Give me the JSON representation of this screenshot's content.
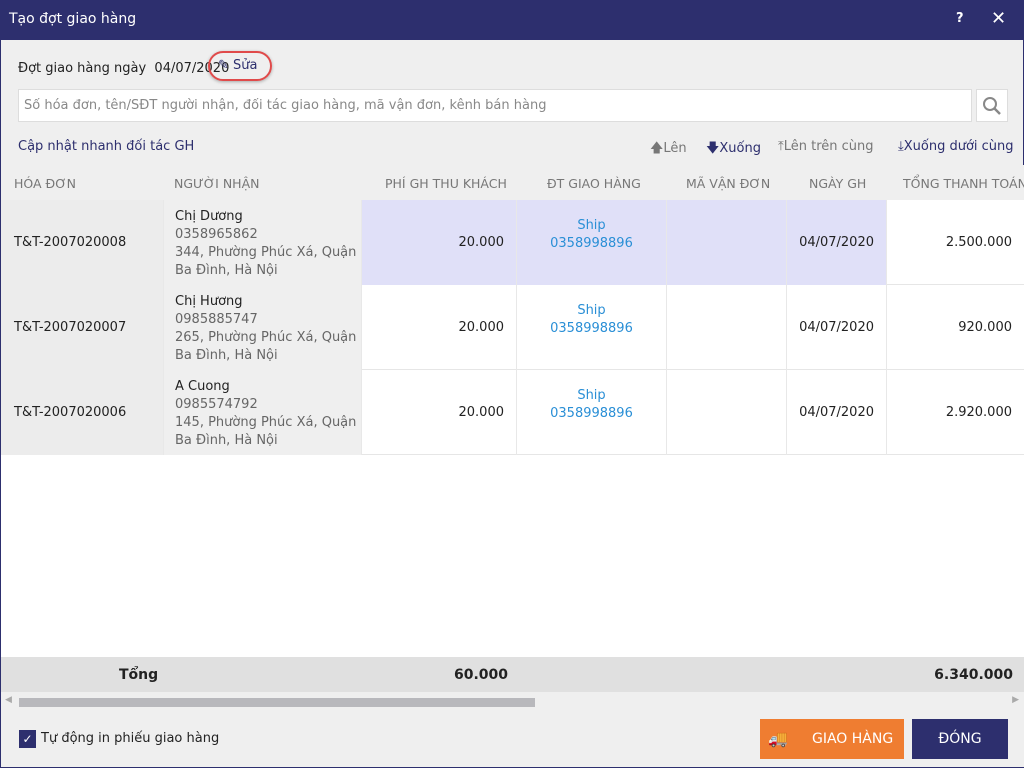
{
  "window": {
    "title": "Tạo đợt giao hàng",
    "help": "?",
    "close": "✕"
  },
  "batch": {
    "label": "Đợt giao hàng ngày",
    "date": "04/07/2020",
    "edit_label": "Sửa"
  },
  "search": {
    "placeholder": "Số hóa đơn, tên/SĐT người nhận, đối tác giao hàng, mã vận đơn, kênh bán hàng",
    "value": ""
  },
  "quick_update": "Cập nhật nhanh đối tác GH",
  "actions": {
    "up": "Lên",
    "down": "Xuống",
    "top": "Lên trên cùng",
    "bottom": "Xuống dưới cùng"
  },
  "columns": [
    "HÓA ĐƠN",
    "NGƯỜI NHẬN",
    "PHÍ GH THU KHÁCH",
    "ĐT GIAO HÀNG",
    "MÃ VẬN ĐƠN",
    "NGÀY GH",
    "TỔNG THANH TOÁN"
  ],
  "rows": [
    {
      "invoice": "T&T-2007020008",
      "name": "Chị Dương",
      "phone": "0358965862",
      "addr1": "344, Phường Phúc Xá, Quận",
      "addr2": "Ba Đình, Hà Nội",
      "fee": "20.000",
      "partner": "Ship",
      "partner_phone": "0358998896",
      "tracking": "",
      "date": "04/07/2020",
      "total": "2.500.000"
    },
    {
      "invoice": "T&T-2007020007",
      "name": "Chị Hương",
      "phone": "0985885747",
      "addr1": "265, Phường Phúc Xá, Quận",
      "addr2": "Ba Đình, Hà Nội",
      "fee": "20.000",
      "partner": "Ship",
      "partner_phone": "0358998896",
      "tracking": "",
      "date": "04/07/2020",
      "total": "920.000"
    },
    {
      "invoice": "T&T-2007020006",
      "name": "A Cuong",
      "phone": "0985574792",
      "addr1": "145, Phường Phúc Xá, Quận",
      "addr2": "Ba Đình, Hà Nội",
      "fee": "20.000",
      "partner": "Ship",
      "partner_phone": "0358998896",
      "tracking": "",
      "date": "04/07/2020",
      "total": "2.920.000"
    }
  ],
  "totals": {
    "label": "Tổng",
    "fee": "60.000",
    "total": "6.340.000"
  },
  "footer": {
    "auto_print": "Tự động in phiếu giao hàng",
    "auto_print_checked": true,
    "deliver": "GIAO HÀNG",
    "close": "ĐÓNG"
  }
}
